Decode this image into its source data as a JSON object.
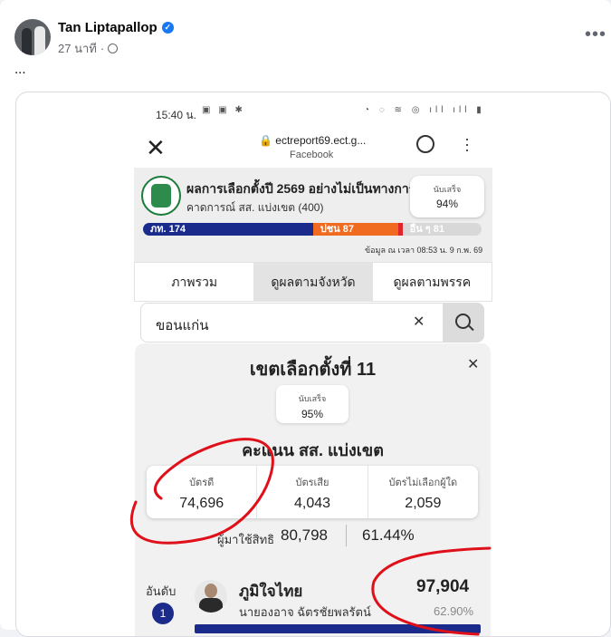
{
  "post": {
    "author": "Tan Liptapallop",
    "time": "27 นาที",
    "time_separator": "·",
    "caption": "..."
  },
  "phone": {
    "status_time": "15:40 น.",
    "browser": {
      "url": "ectreport69.ect.g...",
      "source": "Facebook"
    },
    "app": {
      "title": "ผลการเลือกตั้งปี 2569 อย่างไม่เป็นทางการ",
      "subtitle": "คาดการณ์ สส. แบ่งเขต (400)",
      "counted_label": "นับเสร็จ",
      "counted_value": "94%",
      "seats": [
        {
          "label": "ภท. 174",
          "value": 174,
          "color": "#1a2b8c"
        },
        {
          "label": "ปชน 87",
          "value": 87,
          "color": "#f06a1f"
        },
        {
          "label": "อื่น ๆ 81",
          "value": 81,
          "color": "#d8d8d8"
        }
      ],
      "as_of": "ข้อมูล ณ เวลา 08:53 น. 9 ก.พ. 69"
    },
    "tabs": [
      "ภาพรวม",
      "ดูผลตามจังหวัด",
      "ดูผลตามพรรค"
    ],
    "active_tab": "ดูผลตามจังหวัด",
    "search": {
      "value": "ขอนแก่น"
    },
    "district": {
      "title": "เขตเลือกตั้งที่ 11",
      "counted_label": "นับเสร็จ",
      "counted_value": "95%",
      "score_title": "คะแนน สส. แบ่งเขต",
      "ballots": [
        {
          "label": "บัตรดี",
          "value": "74,696"
        },
        {
          "label": "บัตรเสีย",
          "value": "4,043"
        },
        {
          "label": "บัตรไม่เลือกผู้ใด",
          "value": "2,059"
        }
      ],
      "turnout_label": "ผู้มาใช้สิทธิ",
      "turnout_value": "80,798",
      "turnout_pct": "61.44%"
    },
    "candidate": {
      "rank_label": "อันดับ",
      "rank": "1",
      "party": "ภูมิใจไทย",
      "name": "นายองอาจ ฉัตรชัยพลรัตน์",
      "votes": "97,904",
      "pct": "62.90%",
      "vote_share": 0.629
    }
  },
  "colors": {
    "annotation": "#e0101a",
    "bhumjaithai": "#1a2b8c",
    "people_party": "#f06a1f"
  }
}
